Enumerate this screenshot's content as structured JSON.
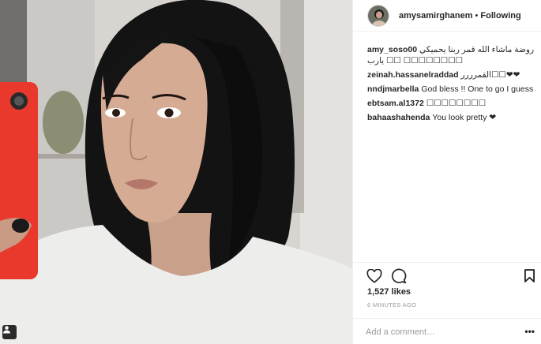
{
  "post": {
    "author": "amysamirghanem",
    "separator": "•",
    "follow_state": "Following"
  },
  "comments": [
    {
      "author": "amy_soso00",
      "text": "روضة ماشاء الله قمر ربنا يحميكي يارب ☐☐ ☐☐☐☐☐☐☐☐"
    },
    {
      "author": "zeinah.hassanelraddad",
      "text": "القمرررر☐☐❤❤"
    },
    {
      "author": "nndjmarbella",
      "text": "God bless !! One to go I guess"
    },
    {
      "author": "ebtsam.al1372",
      "text": "☐☐☐☐☐☐☐☐"
    },
    {
      "author": "bahaashahenda",
      "text": "You look pretty ❤"
    }
  ],
  "engagement": {
    "likes": "1,527 likes",
    "timestamp": "6 MINUTES AGO"
  },
  "comment_box": {
    "placeholder": "Add a comment…",
    "more_label": "•••"
  },
  "icons": {
    "like": "heart-icon",
    "comment": "speech-bubble-icon",
    "save": "bookmark-icon",
    "tag": "person-tag-icon"
  },
  "colors": {
    "text": "#262626",
    "muted": "#999999",
    "divider": "#efefef",
    "phone_case": "#e8392c"
  }
}
